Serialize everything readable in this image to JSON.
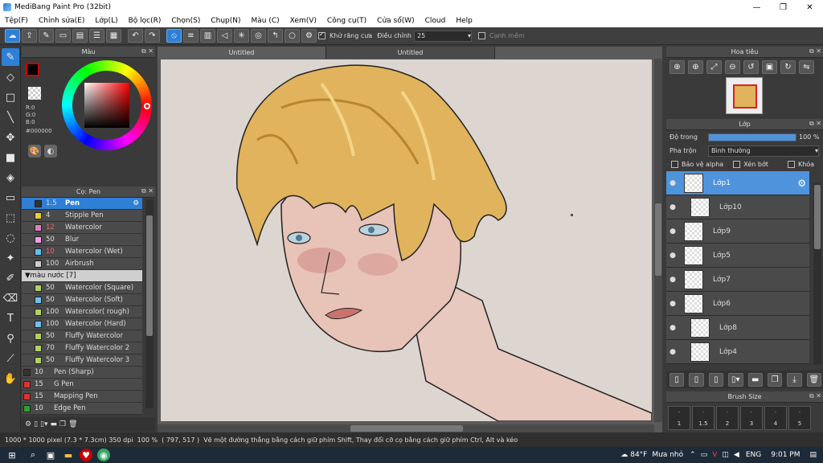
{
  "window": {
    "title": "MediBang Paint Pro (32bit)"
  },
  "menu": [
    "Tệp(F)",
    "Chỉnh sửa(E)",
    "Lớp(L)",
    "Bộ lọc(R)",
    "Chọn(S)",
    "Chụp(N)",
    "Màu (C)",
    "Xem(V)",
    "Công cụ(T)",
    "Cửa sổ(W)",
    "Cloud",
    "Help"
  ],
  "toolbar": {
    "antialias_label": "Khử răng cưa",
    "adjust_label": "Điều chỉnh",
    "adjust_value": "25",
    "edge_label": "Cạnh mềm"
  },
  "color_panel": {
    "title": "Màu",
    "r": "R:0",
    "g": "G:0",
    "b": "B:0",
    "hex": "#000000",
    "primary_color": "#000000"
  },
  "brush_panel": {
    "title": "Cọ: Pen",
    "brushes": [
      {
        "size": "1.5",
        "name": "Pen",
        "color": "#333333",
        "active": true
      },
      {
        "size": "4",
        "name": "Stipple Pen",
        "color": "#e8d030"
      },
      {
        "size": "12",
        "name": "Watercolor",
        "color": "#e080c0",
        "red": true
      },
      {
        "size": "50",
        "name": "Blur",
        "color": "#f0a0e0"
      },
      {
        "size": "10",
        "name": "Watercolor (Wet)",
        "color": "#60c0f0",
        "red": true
      },
      {
        "size": "100",
        "name": "Airbrush",
        "color": "#cccccc"
      }
    ],
    "group_label": "màu nước [7]",
    "group_brushes": [
      {
        "size": "50",
        "name": "Watercolor (Square)",
        "color": "#b0d060"
      },
      {
        "size": "50",
        "name": "Watercolor (Soft)",
        "color": "#70c0f0"
      },
      {
        "size": "100",
        "name": "Watercolor( rough)",
        "color": "#b0d060"
      },
      {
        "size": "100",
        "name": "Watercolor (Hard)",
        "color": "#70c0f0"
      },
      {
        "size": "50",
        "name": "Fluffy Watercolor",
        "color": "#b0d060"
      },
      {
        "size": "70",
        "name": "Fluffy Watercolor 2",
        "color": "#b0d060"
      },
      {
        "size": "50",
        "name": "Fluffy Watercolor 3",
        "color": "#b0d060"
      }
    ],
    "more_brushes": [
      {
        "size": "10",
        "name": "Pen (Sharp)",
        "color": "#333333"
      },
      {
        "size": "15",
        "name": "G Pen",
        "color": "#e03030"
      },
      {
        "size": "15",
        "name": "Mapping Pen",
        "color": "#e03030"
      },
      {
        "size": "10",
        "name": "Edge Pen",
        "color": "#30a030"
      }
    ]
  },
  "tabs": [
    "Untitled",
    "Untitled"
  ],
  "navigator": {
    "title": "Hoa tiêu"
  },
  "layer_panel": {
    "title": "Lớp",
    "opacity_label": "Độ trong",
    "opacity_value": "100 %",
    "opacity_fraction": 1.0,
    "blend_label": "Pha trộn",
    "blend_value": "Bình thường",
    "protect_alpha": "Bảo vệ alpha",
    "clipping": "Xén bớt",
    "lock": "Khóa",
    "layers": [
      {
        "name": "Lớp1",
        "active": true,
        "indent": false
      },
      {
        "name": "Lớp10",
        "active": false,
        "indent": true
      },
      {
        "name": "Lớp9",
        "active": false,
        "indent": false
      },
      {
        "name": "Lớp5",
        "active": false,
        "indent": false
      },
      {
        "name": "Lớp7",
        "active": false,
        "indent": false
      },
      {
        "name": "Lớp6",
        "active": false,
        "indent": false
      },
      {
        "name": "Lớp8",
        "active": false,
        "indent": true
      },
      {
        "name": "Lớp4",
        "active": false,
        "indent": true
      }
    ]
  },
  "brush_size": {
    "title": "Brush Size",
    "sizes": [
      "1",
      "1.5",
      "2",
      "3",
      "4",
      "5"
    ]
  },
  "status": {
    "dimensions": "1000 * 1000 pixel",
    "cm": "(7.3 * 7.3cm)",
    "dpi": "350 dpi",
    "zoom": "100 %",
    "coords": "( 797, 517 )",
    "hint": "Vẽ một đường thẳng bằng cách giữ phím Shift, Thay đổi cỡ cọ bằng cách giữ phím Ctrl, Alt và kéo"
  },
  "taskbar": {
    "weather": "84°F",
    "weather_desc": "Mưa nhỏ",
    "lang": "ENG",
    "time": "9:01 PM"
  },
  "colors": {
    "accent": "#2e7fd6",
    "panel": "#3a3a3a"
  }
}
